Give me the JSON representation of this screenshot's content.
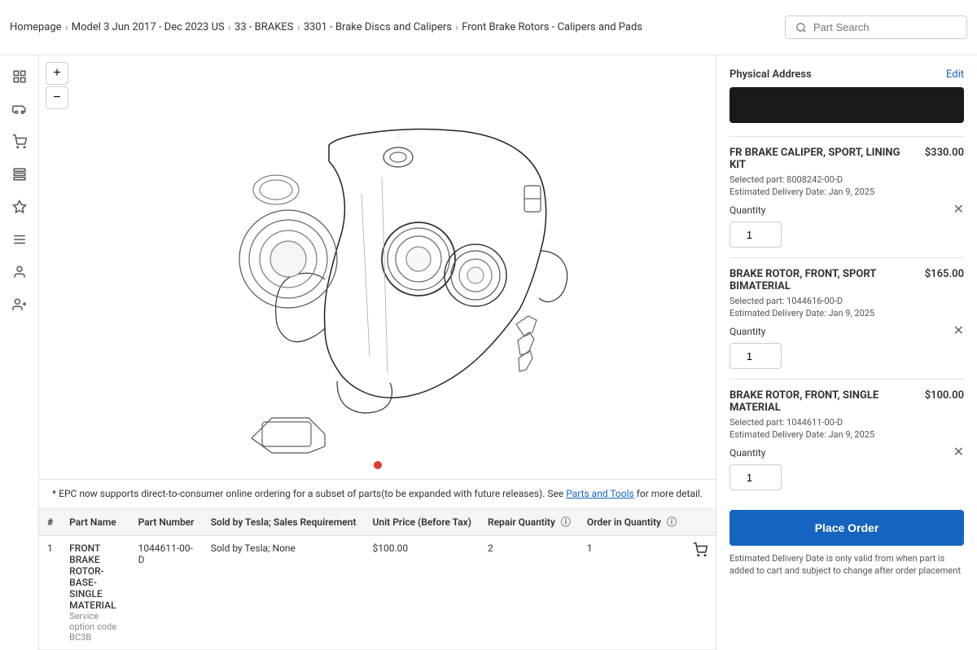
{
  "breadcrumb": {
    "items": [
      {
        "label": "Homepage",
        "link": true
      },
      {
        "label": "Model 3 Jun 2017 - Dec 2023 US",
        "link": true
      },
      {
        "label": "33 - BRAKES",
        "link": true
      },
      {
        "label": "3301 - Brake Discs and Calipers",
        "link": true
      },
      {
        "label": "Front Brake Rotors - Calipers and Pads",
        "link": false
      }
    ]
  },
  "search": {
    "placeholder": "Part Search"
  },
  "sidebar_icons": [
    {
      "name": "grid-icon",
      "glyph": "⊞"
    },
    {
      "name": "car-icon",
      "glyph": "🚗"
    },
    {
      "name": "cart-icon",
      "glyph": "🛒"
    },
    {
      "name": "list-icon",
      "glyph": "📋"
    },
    {
      "name": "dashboard-icon",
      "glyph": "◈"
    },
    {
      "name": "menu-icon",
      "glyph": "☰"
    },
    {
      "name": "user-icon",
      "glyph": "👤"
    },
    {
      "name": "person-add-icon",
      "glyph": "👥"
    }
  ],
  "diagram": {
    "zoom_in_label": "+",
    "zoom_out_label": "−"
  },
  "epc_notice": {
    "text_prefix": "* EPC now supports direct-to-consumer online ordering for a subset of parts(to be expanded with future releases). See ",
    "link_text": "Parts and Tools",
    "text_suffix": " for more detail."
  },
  "table": {
    "columns": [
      "#",
      "Part Name",
      "Part Number",
      "Sold by Tesla; Sales Requirement",
      "Unit Price (Before Tax)",
      "Repair Quantity",
      "Order in Quantity"
    ],
    "rows": [
      {
        "number": "1",
        "part_name": "FRONT BRAKE ROTOR- BASE- SINGLE MATERIAL",
        "service_code": "Service option code BC3B",
        "part_number": "1044611-00-D",
        "sales_req": "Sold by Tesla; None",
        "unit_price": "$100.00",
        "repair_qty": "2",
        "order_qty": "1",
        "has_cart": true
      }
    ]
  },
  "right_panel": {
    "address_title": "Physical Address",
    "edit_label": "Edit",
    "cart_items": [
      {
        "name": "FR BRAKE CALIPER, SPORT, LINING KIT",
        "price": "$330.00",
        "selected_part_label": "Selected part:",
        "selected_part": "8008242-00-D",
        "delivery_label": "Estimated Delivery Date:",
        "delivery_date": "Jan 9, 2025",
        "qty_label": "Quantity",
        "qty_value": "1"
      },
      {
        "name": "BRAKE ROTOR, FRONT, SPORT BIMATERIAL",
        "price": "$165.00",
        "selected_part_label": "Selected part:",
        "selected_part": "1044616-00-D",
        "delivery_label": "Estimated Delivery Date:",
        "delivery_date": "Jan 9, 2025",
        "qty_label": "Quantity",
        "qty_value": "1"
      },
      {
        "name": "BRAKE ROTOR, FRONT, SINGLE MATERIAL",
        "price": "$100.00",
        "selected_part_label": "Selected part:",
        "selected_part": "1044611-00-D",
        "delivery_label": "Estimated Delivery Date:",
        "delivery_date": "Jan 9, 2025",
        "qty_label": "Quantity",
        "qty_value": "1"
      }
    ],
    "place_order_label": "Place Order",
    "delivery_notice": "Estimated Delivery Date is only valid from when part is added to cart and subject to change after order placement"
  }
}
